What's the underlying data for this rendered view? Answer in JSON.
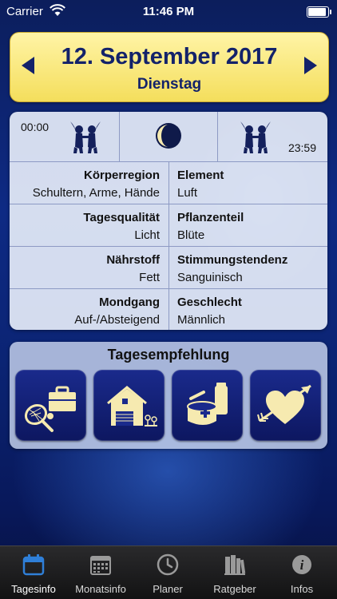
{
  "status_bar": {
    "carrier": "Carrier",
    "time": "11:46 PM",
    "battery_level": 1.0
  },
  "header": {
    "date": "12. September 2017",
    "weekday": "Dienstag"
  },
  "moon_panel": {
    "start_time": "00:00",
    "end_time": "23:59",
    "start_sign_icon": "gemini-icon",
    "end_sign_icon": "gemini-icon",
    "moon_phase_icon": "moon-phase-icon"
  },
  "info_rows": [
    {
      "left_label": "Körperregion",
      "left_value": "Schultern, Arme, Hände",
      "right_label": "Element",
      "right_value": "Luft"
    },
    {
      "left_label": "Tagesqualität",
      "left_value": "Licht",
      "right_label": "Pflanzenteil",
      "right_value": "Blüte"
    },
    {
      "left_label": "Nährstoff",
      "left_value": "Fett",
      "right_label": "Stimmungstendenz",
      "right_value": "Sanguinisch"
    },
    {
      "left_label": "Mondgang",
      "left_value": "Auf-/Absteigend",
      "right_label": "Geschlecht",
      "right_value": "Männlich"
    }
  ],
  "recommendation": {
    "title": "Tagesempfehlung",
    "tiles": [
      {
        "icon": "sport-work-icon"
      },
      {
        "icon": "house-garden-icon"
      },
      {
        "icon": "cosmetics-icon"
      },
      {
        "icon": "heart-arrow-icon"
      }
    ]
  },
  "tab_bar": {
    "active": "Tagesinfo",
    "items": [
      {
        "label": "Tagesinfo",
        "icon": "calendar-icon"
      },
      {
        "label": "Monatsinfo",
        "icon": "month-calendar-icon"
      },
      {
        "label": "Planer",
        "icon": "clock-icon"
      },
      {
        "label": "Ratgeber",
        "icon": "books-icon"
      },
      {
        "label": "Infos",
        "icon": "info-icon"
      }
    ]
  },
  "colors": {
    "accent_yellow": "#f4de5c",
    "navy": "#13226a",
    "tab_active": "#2f7fd8"
  }
}
